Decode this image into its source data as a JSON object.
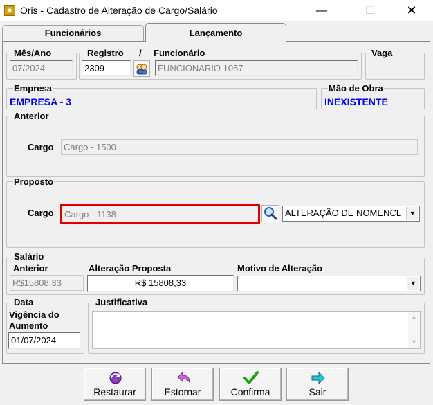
{
  "window": {
    "title": "Oris - Cadastro de Alteração de Cargo/Salário",
    "minimize_glyph": "—",
    "maximize_glyph": "☐",
    "close_glyph": "✕"
  },
  "tabs": [
    {
      "label": "Funcionários",
      "active": false
    },
    {
      "label": "Lançamento",
      "active": true
    }
  ],
  "header": {
    "mes_ano_label": "Mês/Ano",
    "mes_ano_value": "07/2024",
    "registro_label": "Registro",
    "registro_value": "2309",
    "slash": "/",
    "funcionario_label": "Funcionário",
    "funcionario_value": "FUNCIONARIO 1057",
    "vaga_label": "Vaga"
  },
  "empresa": {
    "label": "Empresa",
    "value": "EMPRESA - 3",
    "mao_obra_label": "Mão de Obra",
    "mao_obra_value": "INEXISTENTE"
  },
  "anterior": {
    "group_label": "Anterior",
    "cargo_label": "Cargo",
    "cargo_value": "Cargo - 1500"
  },
  "proposto": {
    "group_label": "Proposto",
    "cargo_label": "Cargo",
    "cargo_value": "Cargo - 1138",
    "motivo_value": "ALTERAÇÃO DE NOMENCL"
  },
  "salario": {
    "group_label": "Salário",
    "anterior_label": "Anterior",
    "anterior_value": "R$15808,33",
    "proposta_label": "Alteração Proposta",
    "proposta_value": "R$ 15808,33",
    "motivo_label": "Motivo de Alteração",
    "motivo_value": ""
  },
  "data": {
    "group_label": "Data",
    "vigencia_label_1": "Vigência do",
    "vigencia_label_2": "Aumento",
    "vigencia_value": "01/07/2024",
    "justificativa_label": "Justificativa",
    "justificativa_value": ""
  },
  "buttons": {
    "restaurar": "Restaurar",
    "estornar": "Estornar",
    "confirma": "Confirma",
    "sair": "Sair"
  },
  "colors": {
    "accent_blue": "#0000ee",
    "highlight_red": "#e00000",
    "window_bg": "#f0f0f0"
  }
}
